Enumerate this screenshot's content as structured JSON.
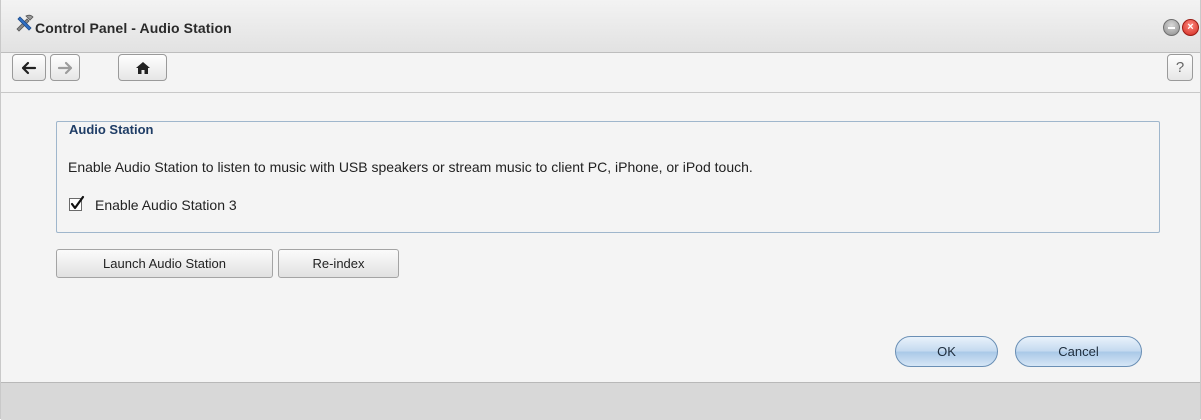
{
  "window": {
    "title": "Control Panel - Audio Station",
    "app_icon": "tools-icon",
    "controls": [
      "minimize-icon",
      "close-icon"
    ]
  },
  "toolbar": {
    "back_icon": "arrow-left-icon",
    "forward_icon": "arrow-right-icon",
    "home_icon": "home-icon",
    "help_label": "?"
  },
  "group": {
    "legend": "Audio Station",
    "description": "Enable Audio Station to listen to music with USB speakers or stream music to client PC, iPhone, or iPod touch.",
    "checkbox_label": "Enable Audio Station 3",
    "checkbox_checked": true
  },
  "actions": {
    "launch_label": "Launch Audio Station",
    "reindex_label": "Re-index"
  },
  "dialog": {
    "ok_label": "OK",
    "cancel_label": "Cancel"
  },
  "colors": {
    "legend_text": "#1f3d66",
    "pill_border": "#6a8fb5",
    "close_button": "#d1281e"
  }
}
